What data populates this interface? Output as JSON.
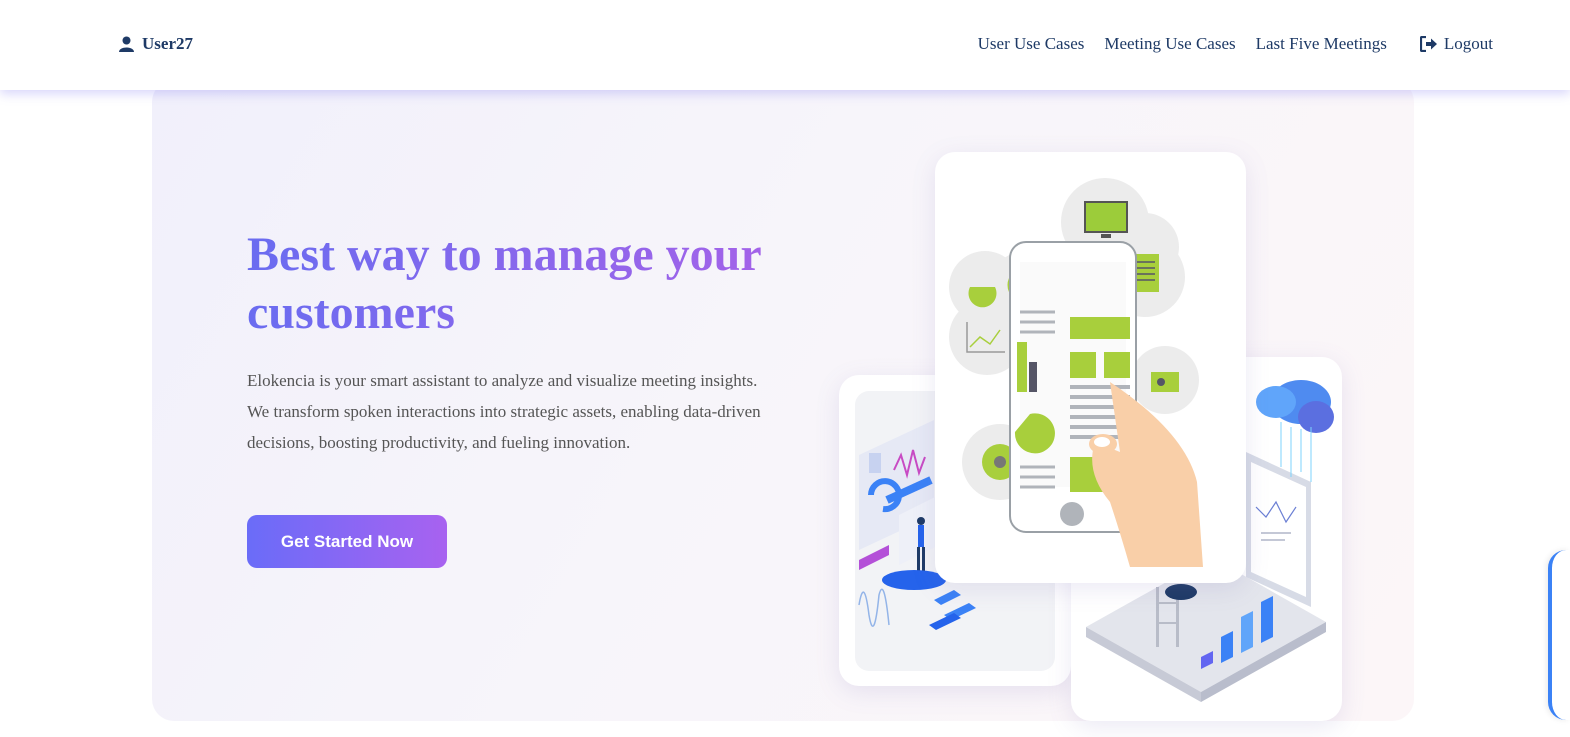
{
  "nav": {
    "user_name": "User27",
    "links": [
      "User Use Cases",
      "Meeting Use Cases",
      "Last Five Meetings"
    ],
    "logout_label": "Logout"
  },
  "hero": {
    "title": "Best way to manage your customers",
    "description": "Elokencia is your smart assistant to analyze and visualize meeting insights. We transform spoken interactions into strategic assets, enabling data-driven decisions, boosting productivity, and fueling innovation.",
    "cta_label": "Get Started Now"
  },
  "colors": {
    "nav_text": "#1e3a66",
    "gradient_start": "#6a6cf0",
    "gradient_end": "#a862e8",
    "accent_green": "#a8cf3c"
  }
}
